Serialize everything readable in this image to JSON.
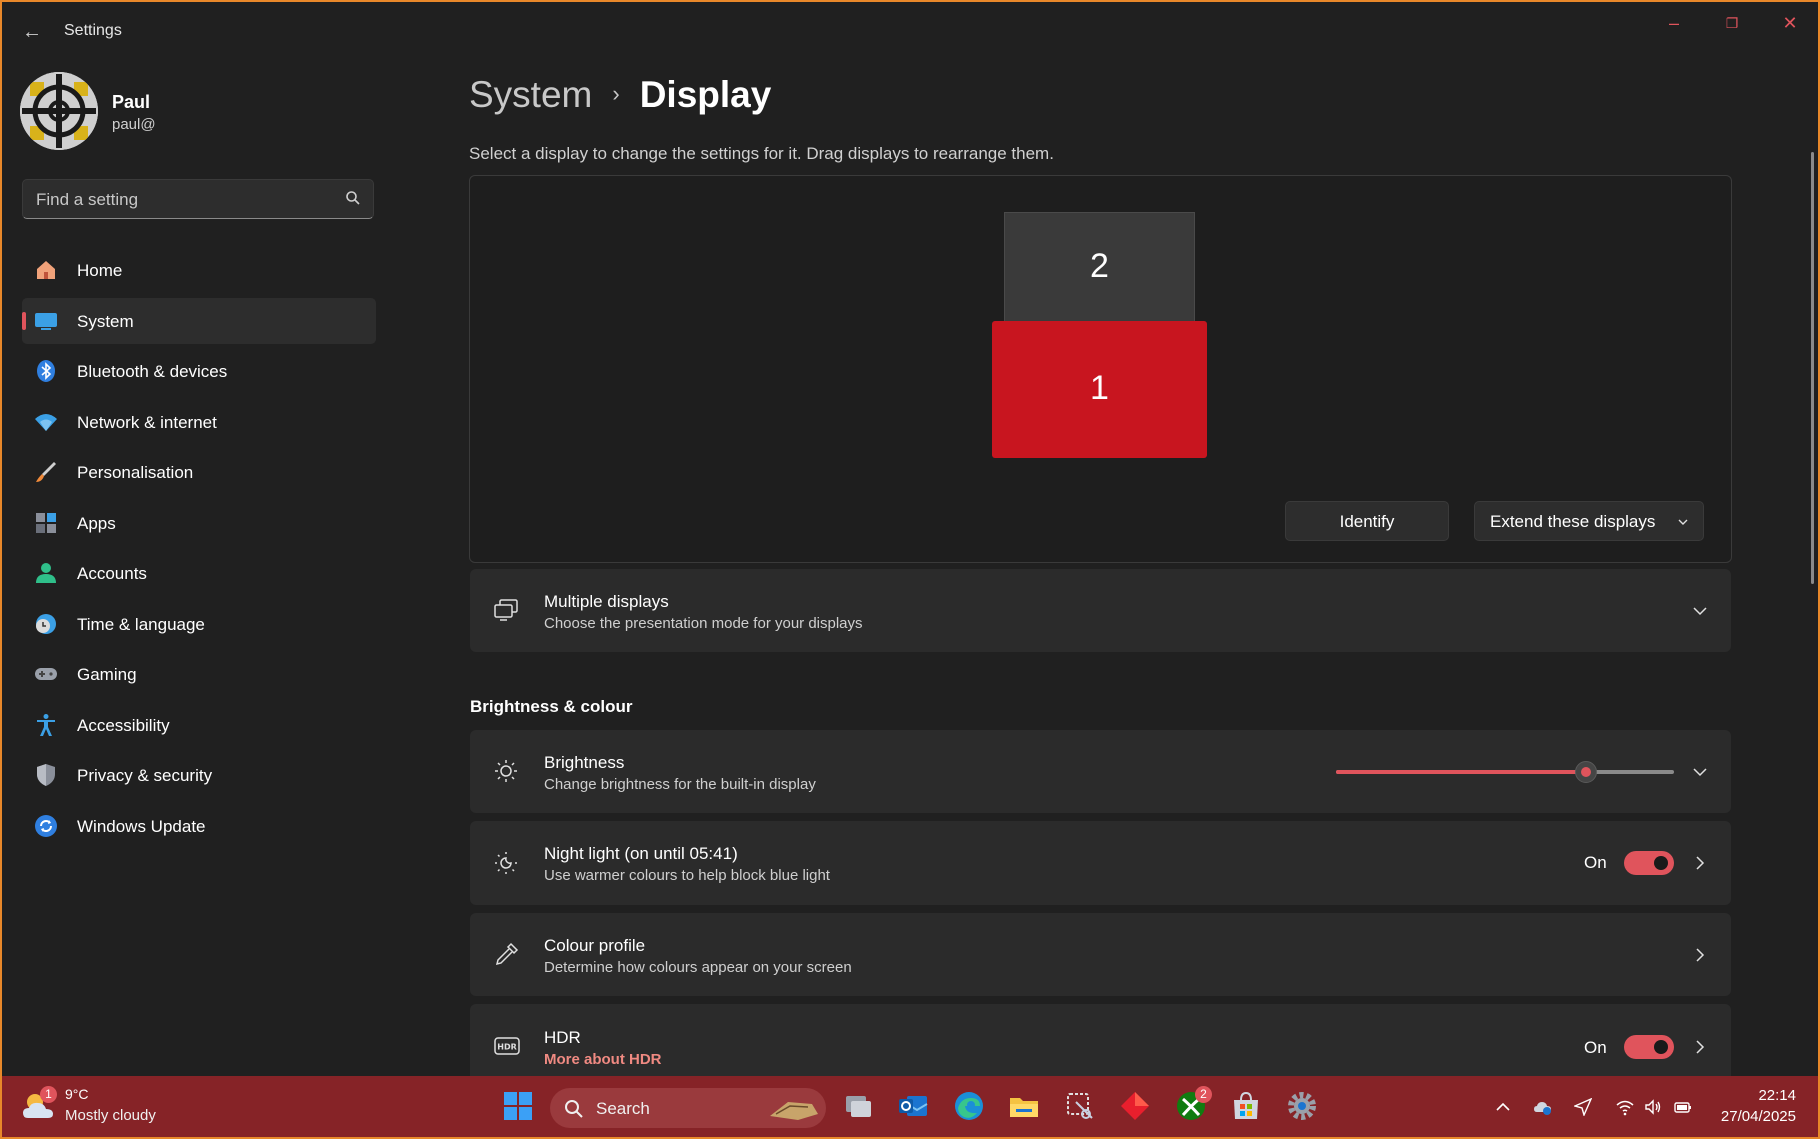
{
  "window": {
    "title": "Settings",
    "back_glyph": "←",
    "minimize_glyph": "–",
    "restore_glyph": "❐",
    "close_glyph": "✕"
  },
  "profile": {
    "name": "Paul",
    "email": "paul@"
  },
  "search": {
    "placeholder": "Find a setting"
  },
  "sidebar": {
    "items": [
      {
        "label": "Home",
        "icon": "home-icon"
      },
      {
        "label": "System",
        "icon": "system-icon",
        "active": true
      },
      {
        "label": "Bluetooth & devices",
        "icon": "bluetooth-icon"
      },
      {
        "label": "Network & internet",
        "icon": "wifi-icon"
      },
      {
        "label": "Personalisation",
        "icon": "brush-icon"
      },
      {
        "label": "Apps",
        "icon": "apps-icon"
      },
      {
        "label": "Accounts",
        "icon": "accounts-icon"
      },
      {
        "label": "Time & language",
        "icon": "time-icon"
      },
      {
        "label": "Gaming",
        "icon": "gamepad-icon"
      },
      {
        "label": "Accessibility",
        "icon": "accessibility-icon"
      },
      {
        "label": "Privacy & security",
        "icon": "shield-icon"
      },
      {
        "label": "Windows Update",
        "icon": "update-icon"
      }
    ]
  },
  "breadcrumb": {
    "parent": "System",
    "separator": "›",
    "current": "Display"
  },
  "display": {
    "instructions": "Select a display to change the settings for it. Drag displays to rearrange them.",
    "monitor_1": "1",
    "monitor_2": "2",
    "identify_label": "Identify",
    "mode_label": "Extend these displays"
  },
  "multiple_displays": {
    "title": "Multiple displays",
    "subtitle": "Choose the presentation mode for your displays"
  },
  "brightness_section": {
    "heading": "Brightness & colour"
  },
  "brightness": {
    "title": "Brightness",
    "subtitle": "Change brightness for the built-in display",
    "level": 0.74
  },
  "night_light": {
    "title": "Night light (on until 05:41)",
    "subtitle": "Use warmer colours to help block blue light",
    "state": "On"
  },
  "colour_profile": {
    "title": "Colour profile",
    "subtitle": "Determine how colours appear on your screen"
  },
  "hdr": {
    "title": "HDR",
    "link": "More about HDR",
    "state": "On"
  },
  "taskbar": {
    "weather_temp": "9°C",
    "weather_desc": "Mostly cloudy",
    "weather_badge": "1",
    "search_label": "Search",
    "xbox_badge": "2",
    "time": "22:14",
    "date": "27/04/2025"
  },
  "colors": {
    "accent": "#e0545c",
    "monitor_selected": "#c8151f",
    "taskbar": "#862327",
    "window_border": "#e8882a"
  }
}
